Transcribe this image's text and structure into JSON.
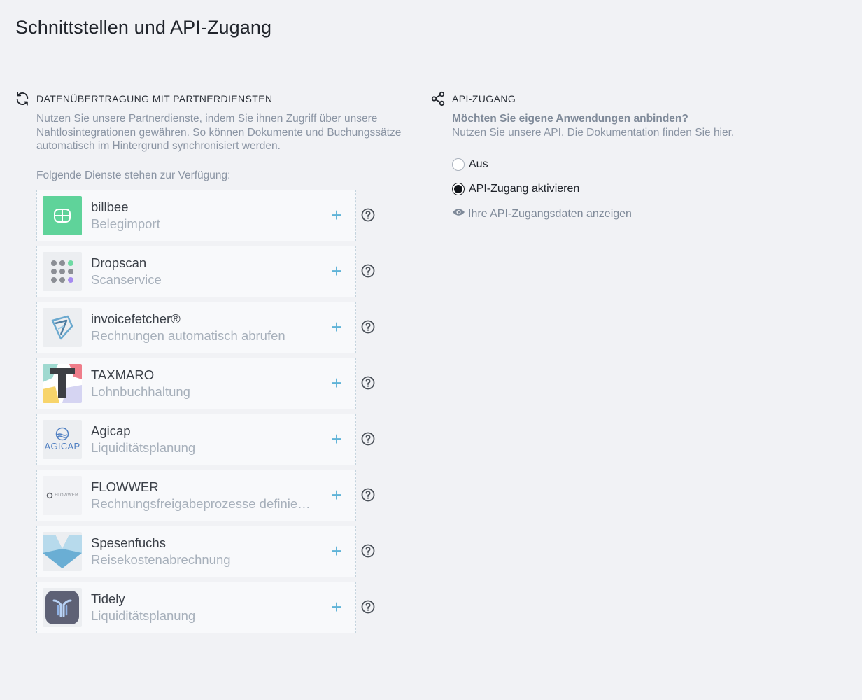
{
  "page": {
    "title": "Schnittstellen und API-Zugang"
  },
  "partners": {
    "title": "DATENÜBERTRAGUNG MIT PARTNERDIENSTEN",
    "description": "Nutzen Sie unsere Partnerdienste, indem Sie ihnen Zugriff über unsere Nahtlosintegrationen gewähren. So können Dokumente und Buchungssätze automatisch im Hintergrund synchronisiert werden.",
    "available_label": "Folgende Dienste stehen zur Verfügung:",
    "services": [
      {
        "name": "billbee",
        "subtitle": "Belegimport",
        "logo": "billbee-logo"
      },
      {
        "name": "Dropscan",
        "subtitle": "Scanservice",
        "logo": "dropscan-logo"
      },
      {
        "name": "invoicefetcher®",
        "subtitle": "Rechnungen automatisch abrufen",
        "logo": "invoicefetcher-logo"
      },
      {
        "name": "TAXMARO",
        "subtitle": "Lohnbuchhaltung",
        "logo": "taxmaro-logo"
      },
      {
        "name": "Agicap",
        "subtitle": "Liquiditätsplanung",
        "logo": "agicap-logo",
        "logo_text": "AGICAP"
      },
      {
        "name": "FLOWWER",
        "subtitle": "Rechnungsfreigabeprozesse definieren",
        "logo": "flowwer-logo",
        "logo_text": "FLOWWER"
      },
      {
        "name": "Spesenfuchs",
        "subtitle": "Reisekostenabrechnung",
        "logo": "spesenfuchs-logo"
      },
      {
        "name": "Tidely",
        "subtitle": "Liquiditätsplanung",
        "logo": "tidely-logo"
      }
    ],
    "add_symbol": "+",
    "colors": {
      "accent": "#5fb3d7"
    }
  },
  "api": {
    "title": "API-ZUGANG",
    "question": "Möchten Sie eigene Anwendungen anbinden?",
    "doc_text": "Nutzen Sie unsere API. Die Dokumentation finden Sie ",
    "doc_link": "hier",
    "doc_suffix": ".",
    "options": [
      {
        "label": "Aus",
        "checked": false
      },
      {
        "label": "API-Zugang aktivieren",
        "checked": true
      }
    ],
    "show_credentials": "Ihre API-Zugangsdaten anzeigen"
  }
}
